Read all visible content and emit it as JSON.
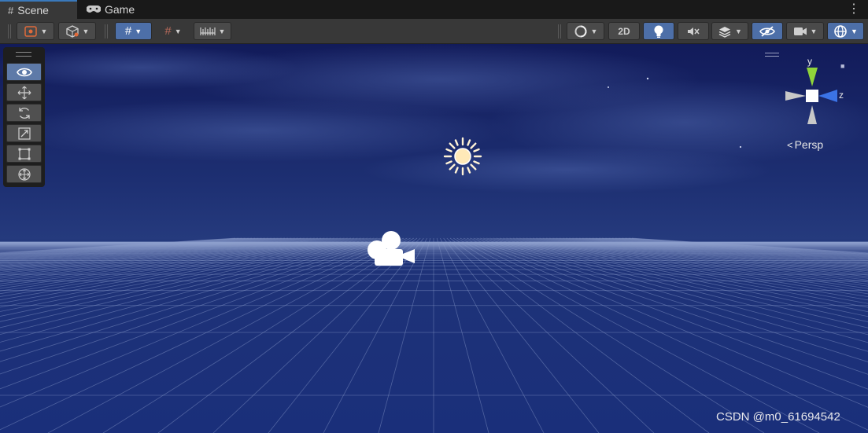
{
  "tabs": [
    {
      "label": "Scene",
      "icon": "hash-grid-icon",
      "active": true
    },
    {
      "label": "Game",
      "icon": "gamepad-icon",
      "active": false
    }
  ],
  "toolbar": {
    "two_d_label": "2D",
    "accent": "#4d6fa8"
  },
  "tools": [
    {
      "name": "view-tool",
      "icon": "eye-icon",
      "active": true
    },
    {
      "name": "move-tool",
      "icon": "move-arrows-icon",
      "active": false
    },
    {
      "name": "rotate-tool",
      "icon": "rotate-icon",
      "active": false
    },
    {
      "name": "scale-tool",
      "icon": "scale-icon",
      "active": false
    },
    {
      "name": "rect-tool",
      "icon": "rect-transform-icon",
      "active": false
    },
    {
      "name": "transform-tool",
      "icon": "transform-icon",
      "active": false
    }
  ],
  "gizmo": {
    "y_label": "y",
    "z_label": "z",
    "projection_label": "Persp",
    "colors": {
      "y": "#8fd43a",
      "z": "#3b73e6",
      "neutral": "#c8c8c8"
    }
  },
  "watermark": "CSDN @m0_61694542",
  "scene_colors": {
    "sky_top": "#152163",
    "horizon": "#1f3377",
    "grid_line": "#8f9fcf"
  }
}
